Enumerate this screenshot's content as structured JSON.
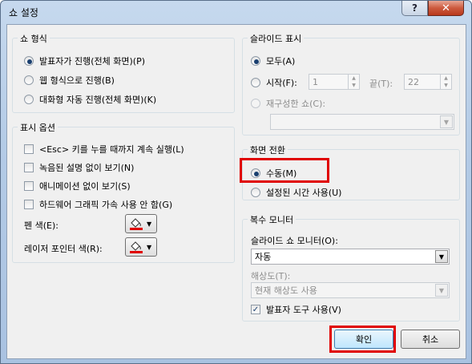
{
  "window": {
    "title": "쇼 설정",
    "help_label": "?",
    "close_label": "✕"
  },
  "show_type": {
    "title": "쇼 형식",
    "options": [
      {
        "label": "발표자가 진행(전체 화면)(P)",
        "checked": true
      },
      {
        "label": "웹 형식으로 진행(B)",
        "checked": false
      },
      {
        "label": "대화형 자동 진행(전체 화면)(K)",
        "checked": false
      }
    ]
  },
  "show_options": {
    "title": "표시 옵션",
    "checks": [
      {
        "label": "<Esc> 키를 누를 때까지 계속 실행(L)",
        "checked": false
      },
      {
        "label": "녹음된 설명 없이 보기(N)",
        "checked": false
      },
      {
        "label": "애니메이션 없이 보기(S)",
        "checked": false
      },
      {
        "label": "하드웨어 그래픽 가속 사용 안 함(G)",
        "checked": false
      }
    ],
    "pen_color_label": "펜 색(E):",
    "laser_color_label": "레이저 포인터 색(R):",
    "pen_color": "#e00000",
    "laser_color": "#e00000"
  },
  "show_slides": {
    "title": "슬라이드 표시",
    "all_label": "모두(A)",
    "from_label": "시작(F):",
    "from_value": "1",
    "to_label": "끝(T):",
    "to_value": "22",
    "custom_label": "재구성한 쇼(C):",
    "custom_value": ""
  },
  "advance": {
    "title": "화면 전환",
    "manual_label": "수동(M)",
    "timings_label": "설정된 시간 사용(U)"
  },
  "multi_monitor": {
    "title": "복수 모니터",
    "monitor_label": "슬라이드 쇼 모니터(O):",
    "monitor_value": "자동",
    "resolution_label": "해상도(T):",
    "resolution_value": "현재 해상도 사용",
    "presenter_view_label": "발표자 도구 사용(V)",
    "presenter_view_checked": true
  },
  "buttons": {
    "ok": "확인",
    "cancel": "취소"
  },
  "accent": "#e00000"
}
